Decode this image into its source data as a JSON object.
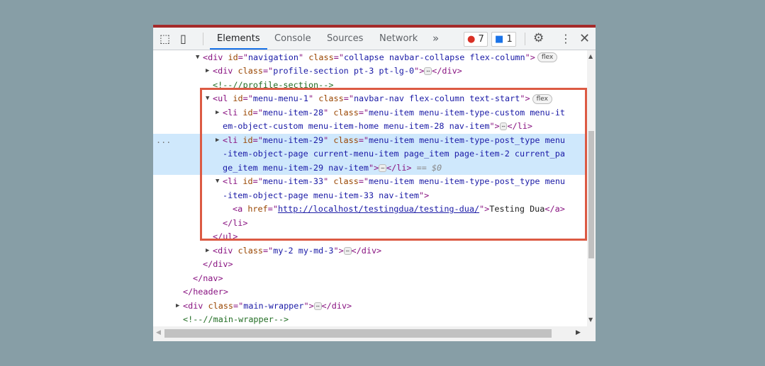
{
  "toolbar": {
    "tabs": [
      "Elements",
      "Console",
      "Sources",
      "Network"
    ],
    "more": "»",
    "errors": "7",
    "messages": "1",
    "error_color": "#d93025",
    "message_color": "#1a73e8"
  },
  "dom": {
    "selected_marker": "...",
    "rows": [
      {
        "indent": 70,
        "arrow": "▼",
        "tokens": [
          [
            "tag",
            "<div "
          ],
          [
            "attr",
            "id"
          ],
          [
            "tag",
            "=\""
          ],
          [
            "val",
            "navigation"
          ],
          [
            "tag",
            "\" "
          ],
          [
            "attr",
            "class"
          ],
          [
            "tag",
            "=\""
          ],
          [
            "val",
            "collapse navbar-collapse flex-column"
          ],
          [
            "tag",
            "\">"
          ],
          [
            "pill",
            "flex"
          ]
        ]
      },
      {
        "indent": 84,
        "arrow": "▶",
        "tokens": [
          [
            "tag",
            "<div "
          ],
          [
            "attr",
            "class"
          ],
          [
            "tag",
            "=\""
          ],
          [
            "val",
            "profile-section pt-3 pt-lg-0"
          ],
          [
            "tag",
            "\">"
          ],
          [
            "ell",
            "⋯"
          ],
          [
            "tag",
            "</div>"
          ]
        ]
      },
      {
        "indent": 84,
        "tokens": [
          [
            "com",
            "<!--//profile-section-->"
          ]
        ]
      },
      {
        "indent": 84,
        "arrow": "▼",
        "tokens": [
          [
            "tag",
            "<ul "
          ],
          [
            "attr",
            "id"
          ],
          [
            "tag",
            "=\""
          ],
          [
            "val",
            "menu-menu-1"
          ],
          [
            "tag",
            "\" "
          ],
          [
            "attr",
            "class"
          ],
          [
            "tag",
            "=\""
          ],
          [
            "val",
            "navbar-nav flex-column text-start"
          ],
          [
            "tag",
            "\">"
          ],
          [
            "pill",
            "flex"
          ]
        ]
      },
      {
        "indent": 98,
        "arrow": "▶",
        "tokens": [
          [
            "tag",
            "<li "
          ],
          [
            "attr",
            "id"
          ],
          [
            "tag",
            "=\""
          ],
          [
            "val",
            "menu-item-28"
          ],
          [
            "tag",
            "\" "
          ],
          [
            "attr",
            "class"
          ],
          [
            "tag",
            "=\""
          ],
          [
            "val",
            "menu-item menu-item-type-custom menu-it"
          ]
        ]
      },
      {
        "indent": 98,
        "tokens": [
          [
            "val",
            "em-object-custom menu-item-home menu-item-28 nav-item"
          ],
          [
            "tag",
            "\">"
          ],
          [
            "ell",
            "⋯"
          ],
          [
            "tag",
            "</li>"
          ]
        ]
      },
      {
        "indent": 98,
        "arrow": "▶",
        "sel": true,
        "tokens": [
          [
            "tag",
            "<li "
          ],
          [
            "attr",
            "id"
          ],
          [
            "tag",
            "=\""
          ],
          [
            "val",
            "menu-item-29"
          ],
          [
            "tag",
            "\" "
          ],
          [
            "attr",
            "class"
          ],
          [
            "tag",
            "=\""
          ],
          [
            "val",
            "menu-item menu-item-type-post_type menu"
          ]
        ]
      },
      {
        "indent": 98,
        "sel": true,
        "tokens": [
          [
            "val",
            "-item-object-page current-menu-item page_item page-item-2 current_pa"
          ]
        ]
      },
      {
        "indent": 98,
        "sel": true,
        "tokens": [
          [
            "val",
            "ge_item menu-item-29 nav-item"
          ],
          [
            "tag",
            "\">"
          ],
          [
            "ell",
            "⋯"
          ],
          [
            "tag",
            "</li>"
          ],
          [
            "dim",
            " == $0"
          ]
        ]
      },
      {
        "indent": 98,
        "arrow": "▼",
        "tokens": [
          [
            "tag",
            "<li "
          ],
          [
            "attr",
            "id"
          ],
          [
            "tag",
            "=\""
          ],
          [
            "val",
            "menu-item-33"
          ],
          [
            "tag",
            "\" "
          ],
          [
            "attr",
            "class"
          ],
          [
            "tag",
            "=\""
          ],
          [
            "val",
            "menu-item menu-item-type-post_type menu"
          ]
        ]
      },
      {
        "indent": 98,
        "tokens": [
          [
            "val",
            "-item-object-page menu-item-33 nav-item"
          ],
          [
            "tag",
            "\">"
          ]
        ]
      },
      {
        "indent": 112,
        "tokens": [
          [
            "tag",
            "<a "
          ],
          [
            "attr",
            "href"
          ],
          [
            "tag",
            "=\""
          ],
          [
            "link",
            "http://localhost/testingdua/testing-dua/"
          ],
          [
            "tag",
            "\">"
          ],
          [
            "txt",
            "Testing Dua"
          ],
          [
            "tag",
            "</a>"
          ]
        ]
      },
      {
        "indent": 98,
        "tokens": [
          [
            "tag",
            "</li>"
          ]
        ]
      },
      {
        "indent": 84,
        "tokens": [
          [
            "tag",
            "</ul>"
          ]
        ]
      },
      {
        "indent": 84,
        "arrow": "▶",
        "tokens": [
          [
            "tag",
            "<div "
          ],
          [
            "attr",
            "class"
          ],
          [
            "tag",
            "=\""
          ],
          [
            "val",
            "my-2 my-md-3"
          ],
          [
            "tag",
            "\">"
          ],
          [
            "ell",
            "⋯"
          ],
          [
            "tag",
            "</div>"
          ]
        ]
      },
      {
        "indent": 70,
        "tokens": [
          [
            "tag",
            "</div>"
          ]
        ]
      },
      {
        "indent": 56,
        "tokens": [
          [
            "tag",
            "</nav>"
          ]
        ]
      },
      {
        "indent": 42,
        "tokens": [
          [
            "tag",
            "</header>"
          ]
        ]
      },
      {
        "indent": 42,
        "arrow": "▶",
        "tokens": [
          [
            "tag",
            "<div "
          ],
          [
            "attr",
            "class"
          ],
          [
            "tag",
            "=\""
          ],
          [
            "val",
            "main-wrapper"
          ],
          [
            "tag",
            "\">"
          ],
          [
            "ell",
            "⋯"
          ],
          [
            "tag",
            "</div>"
          ]
        ]
      },
      {
        "indent": 42,
        "tokens": [
          [
            "com",
            "<!--//main-wrapper-->"
          ]
        ]
      }
    ]
  }
}
